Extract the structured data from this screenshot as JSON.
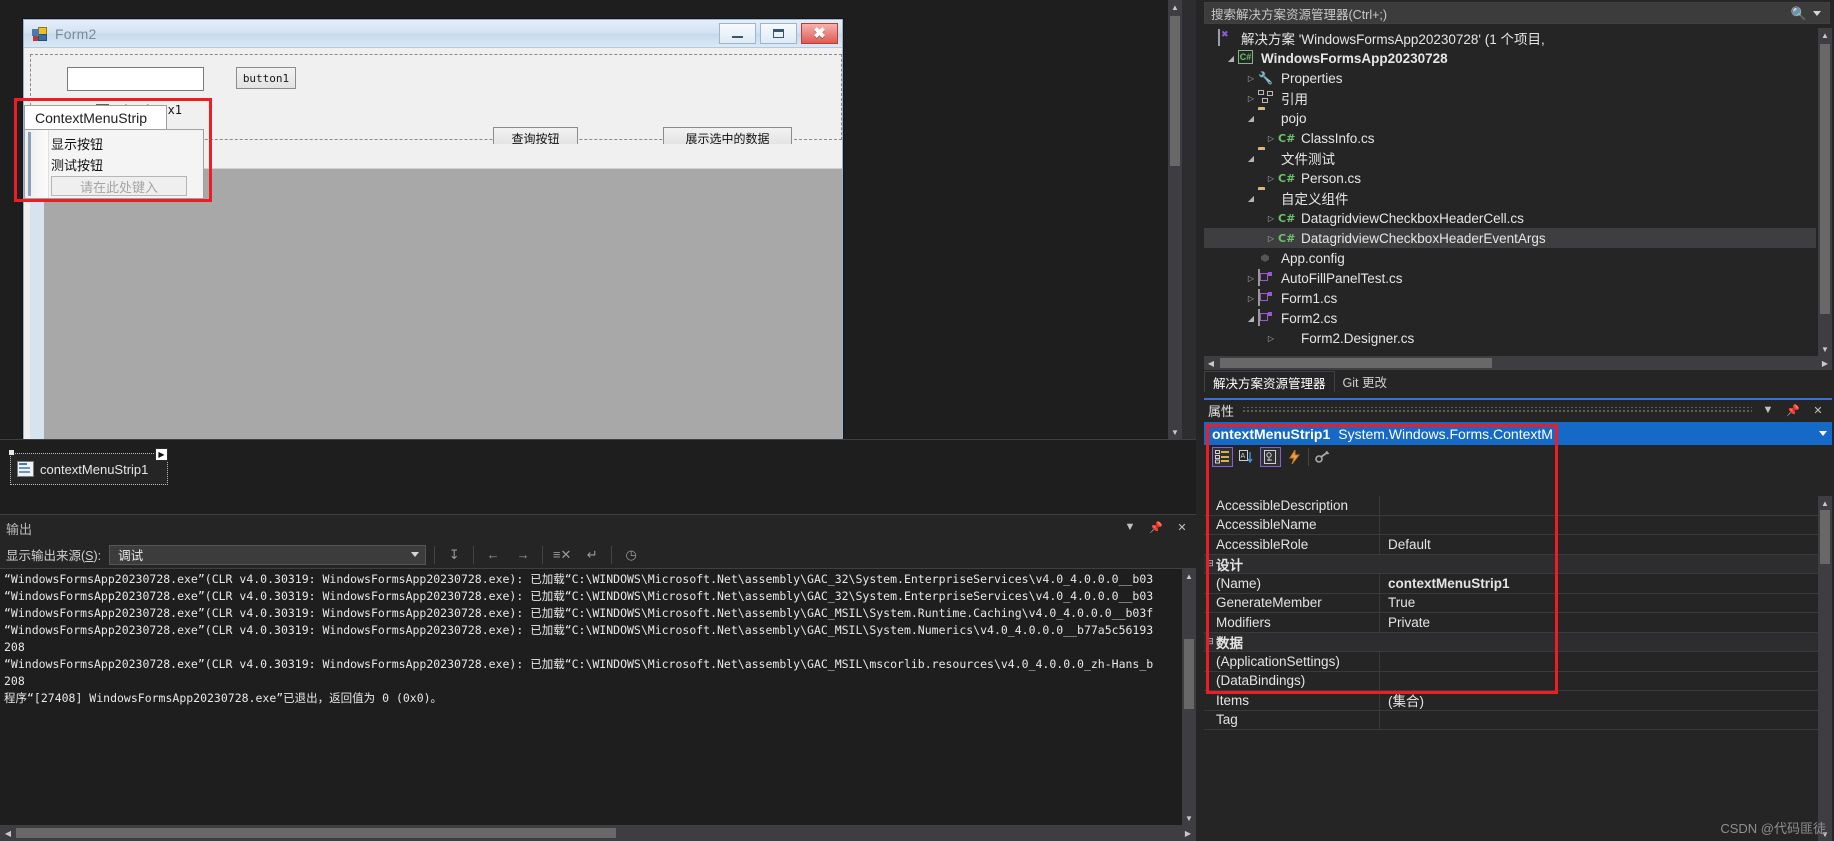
{
  "form_designer": {
    "window_title": "Form2",
    "caption_buttons": {
      "minimize": "minimize-button",
      "maximize": "maximize-button",
      "close": "close-button"
    },
    "controls": {
      "textbox1_value": "",
      "button1_label": "button1",
      "checkbox1_label": "checkBox1",
      "query_button_label": "查询按钮",
      "show_selected_button_label": "展示选中的数据"
    },
    "context_menu_editor": {
      "tab_label": "ContextMenuStrip",
      "items": [
        "显示按钮",
        "测试按钮"
      ],
      "placeholder": "请在此处键入"
    },
    "component_tray": {
      "item_label": "contextMenuStrip1"
    }
  },
  "output_panel": {
    "title": "输出",
    "source_label_pre": "显示输出来源(",
    "source_label_key": "S",
    "source_label_post": "):",
    "source_value": "调试",
    "toolbar_icons": [
      "clear-all-icon",
      "navigate-previous-icon",
      "navigate-next-icon",
      "clear-output-icon",
      "toggle-word-wrap-icon",
      "show-timestamps-icon"
    ],
    "lines": [
      "“WindowsFormsApp20230728.exe”(CLR v4.0.30319: WindowsFormsApp20230728.exe): 已加载“C:\\WINDOWS\\Microsoft.Net\\assembly\\GAC_32\\System.EnterpriseServices\\v4.0_4.0.0.0__b03",
      "“WindowsFormsApp20230728.exe”(CLR v4.0.30319: WindowsFormsApp20230728.exe): 已加载“C:\\WINDOWS\\Microsoft.Net\\assembly\\GAC_32\\System.EnterpriseServices\\v4.0_4.0.0.0__b03",
      "“WindowsFormsApp20230728.exe”(CLR v4.0.30319: WindowsFormsApp20230728.exe): 已加载“C:\\WINDOWS\\Microsoft.Net\\assembly\\GAC_MSIL\\System.Runtime.Caching\\v4.0_4.0.0.0__b03f",
      "“WindowsFormsApp20230728.exe”(CLR v4.0.30319: WindowsFormsApp20230728.exe): 已加载“C:\\WINDOWS\\Microsoft.Net\\assembly\\GAC_MSIL\\System.Numerics\\v4.0_4.0.0.0__b77a5c56193",
      "208",
      "“WindowsFormsApp20230728.exe”(CLR v4.0.30319: WindowsFormsApp20230728.exe): 已加载“C:\\WINDOWS\\Microsoft.Net\\assembly\\GAC_MSIL\\mscorlib.resources\\v4.0_4.0.0.0_zh-Hans_b",
      "208",
      "程序“[27408] WindowsFormsApp20230728.exe”已退出，返回值为 0 (0x0)。"
    ]
  },
  "solution_explorer": {
    "search_placeholder": "搜索解决方案资源管理器(Ctrl+;)",
    "search_icon": "search-icon",
    "tree": [
      {
        "label": "解决方案 'WindowsFormsApp20230728' (1 个项目,",
        "indent": 0,
        "twisty": "none",
        "icon": "solution-icon",
        "bold": false,
        "selected": false
      },
      {
        "label": "WindowsFormsApp20230728",
        "indent": 1,
        "twisty": "expanded",
        "icon": "csharp-project-icon",
        "bold": true,
        "selected": false
      },
      {
        "label": "Properties",
        "indent": 2,
        "twisty": "collapsed",
        "icon": "wrench-icon",
        "bold": false,
        "selected": false
      },
      {
        "label": "引用",
        "indent": 2,
        "twisty": "collapsed",
        "icon": "references-icon",
        "bold": false,
        "selected": false
      },
      {
        "label": "pojo",
        "indent": 2,
        "twisty": "expanded",
        "icon": "folder-icon",
        "bold": false,
        "selected": false
      },
      {
        "label": "ClassInfo.cs",
        "indent": 3,
        "twisty": "collapsed",
        "icon": "csharp-file-icon",
        "bold": false,
        "selected": false
      },
      {
        "label": "文件测试",
        "indent": 2,
        "twisty": "expanded",
        "icon": "folder-icon",
        "bold": false,
        "selected": false
      },
      {
        "label": "Person.cs",
        "indent": 3,
        "twisty": "collapsed",
        "icon": "csharp-file-icon",
        "bold": false,
        "selected": false
      },
      {
        "label": "自定义组件",
        "indent": 2,
        "twisty": "expanded",
        "icon": "folder-icon",
        "bold": false,
        "selected": false
      },
      {
        "label": "DatagridviewCheckboxHeaderCell.cs",
        "indent": 3,
        "twisty": "collapsed",
        "icon": "csharp-file-icon",
        "bold": false,
        "selected": false
      },
      {
        "label": "DatagridviewCheckboxHeaderEventArgs",
        "indent": 3,
        "twisty": "collapsed",
        "icon": "csharp-file-icon",
        "bold": false,
        "selected": true
      },
      {
        "label": "App.config",
        "indent": 2,
        "twisty": "none",
        "icon": "config-icon",
        "bold": false,
        "selected": false
      },
      {
        "label": "AutoFillPanelTest.cs",
        "indent": 2,
        "twisty": "collapsed",
        "icon": "form-icon",
        "bold": false,
        "selected": false
      },
      {
        "label": "Form1.cs",
        "indent": 2,
        "twisty": "collapsed",
        "icon": "form-icon",
        "bold": false,
        "selected": false
      },
      {
        "label": "Form2.cs",
        "indent": 2,
        "twisty": "expanded",
        "icon": "form-icon",
        "bold": false,
        "selected": false
      },
      {
        "label": "Form2.Designer.cs",
        "indent": 3,
        "twisty": "collapsed",
        "icon": "designer-file-icon",
        "bold": false,
        "selected": false
      }
    ],
    "tabs": [
      {
        "label": "解决方案资源管理器",
        "active": true
      },
      {
        "label": "Git 更改",
        "active": false
      }
    ]
  },
  "properties_window": {
    "title": "属性",
    "header_buttons": [
      "chevron-down-icon",
      "pin-icon",
      "close-icon"
    ],
    "selected_object_name": "ontextMenuStrip1",
    "selected_object_type": "System.Windows.Forms.ContextM",
    "toolbar_buttons": [
      "categorized-view-icon",
      "alphabetical-view-icon",
      "properties-icon",
      "events-icon",
      "property-pages-icon"
    ],
    "rows": [
      {
        "type": "prop",
        "name": "AccessibleDescription",
        "value": "",
        "bold": false
      },
      {
        "type": "prop",
        "name": "AccessibleName",
        "value": "",
        "bold": false
      },
      {
        "type": "prop",
        "name": "AccessibleRole",
        "value": "Default",
        "bold": false
      },
      {
        "type": "category",
        "name": "设计",
        "value": "",
        "bold": false
      },
      {
        "type": "prop",
        "name": "(Name)",
        "value": "contextMenuStrip1",
        "bold": true
      },
      {
        "type": "prop",
        "name": "GenerateMember",
        "value": "True",
        "bold": false
      },
      {
        "type": "prop",
        "name": "Modifiers",
        "value": "Private",
        "bold": false
      },
      {
        "type": "category",
        "name": "数据",
        "value": "",
        "bold": false
      },
      {
        "type": "prop",
        "name": "(ApplicationSettings)",
        "value": "",
        "bold": false
      },
      {
        "type": "prop",
        "name": "(DataBindings)",
        "value": "",
        "bold": false
      },
      {
        "type": "prop",
        "name": "Items",
        "value": "(集合)",
        "bold": false
      },
      {
        "type": "prop",
        "name": "Tag",
        "value": "",
        "bold": false
      }
    ]
  },
  "watermark": "CSDN @代码匪徒",
  "colors": {
    "accent_blue": "#1569c7",
    "highlight_red": "#ee1c24",
    "dock_background": "#252526",
    "editor_background": "#1e1e1e"
  }
}
